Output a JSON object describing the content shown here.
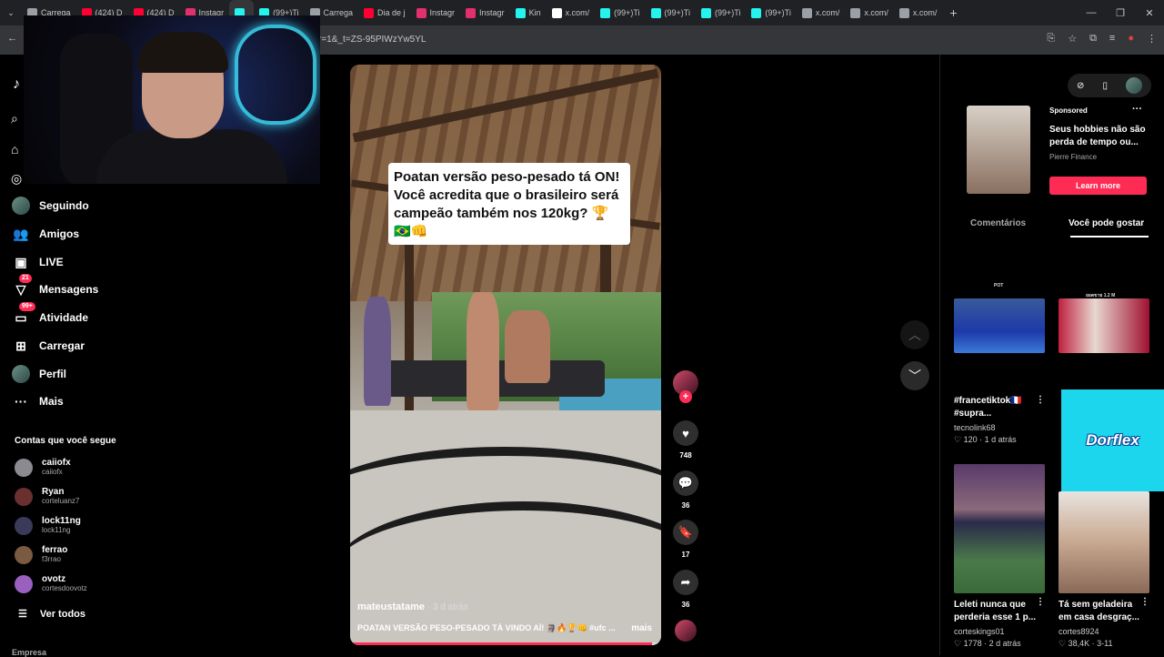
{
  "browser": {
    "tabs": [
      {
        "label": "Carrega",
        "color": "#9aa0a6"
      },
      {
        "label": "(424) D",
        "color": "#ff0033"
      },
      {
        "label": "(424) D",
        "color": "#ff0033"
      },
      {
        "label": "Instagr",
        "color": "#e1306c"
      },
      {
        "label": "",
        "color": "#25f4ee"
      },
      {
        "label": "(99+)Ti",
        "color": "#25f4ee"
      },
      {
        "label": "Carrega",
        "color": "#9aa0a6"
      },
      {
        "label": "Dia de j",
        "color": "#ff0033"
      },
      {
        "label": "Instagr",
        "color": "#e1306c"
      },
      {
        "label": "Instagr",
        "color": "#e1306c"
      },
      {
        "label": "Kin",
        "color": "#25f4ee"
      },
      {
        "label": "x.com/",
        "color": "#ffffff"
      },
      {
        "label": "(99+)Ti",
        "color": "#25f4ee"
      },
      {
        "label": "(99+)Ti",
        "color": "#25f4ee"
      },
      {
        "label": "(99+)Ti",
        "color": "#25f4ee"
      },
      {
        "label": "(99+)Ti",
        "color": "#25f4ee"
      },
      {
        "label": "x.com/",
        "color": "#9aa0a6"
      },
      {
        "label": "x.com/",
        "color": "#9aa0a6"
      },
      {
        "label": "x.com/",
        "color": "#9aa0a6"
      }
    ],
    "new_tab": "+",
    "url": "r=1&_t=ZS-95PIWzYw5YL"
  },
  "sidebar": {
    "items": [
      {
        "label": "Seguindo",
        "icon": "following-icon"
      },
      {
        "label": "Amigos",
        "icon": "friends-icon"
      },
      {
        "label": "LIVE",
        "icon": "live-icon"
      },
      {
        "label": "Mensagens",
        "icon": "messages-icon",
        "badge": "21"
      },
      {
        "label": "Atividade",
        "icon": "activity-icon",
        "badge": "99+"
      },
      {
        "label": "Carregar",
        "icon": "upload-icon"
      },
      {
        "label": "Perfil",
        "icon": "profile-avatar"
      },
      {
        "label": "Mais",
        "icon": "more-icon"
      }
    ],
    "section_title": "Contas que você segue",
    "accounts": [
      {
        "name": "caiiofx",
        "handle": "caiiofx",
        "color": "#8a8a90"
      },
      {
        "name": "Ryan",
        "handle": "corteluanz7",
        "color": "#6a3030"
      },
      {
        "name": "lock11ng",
        "handle": "lock11ng",
        "color": "#3a3a5a"
      },
      {
        "name": "ferrao",
        "handle": "f3rrao",
        "color": "#7a5a40"
      },
      {
        "name": "ovotz",
        "handle": "cortesdoovotz",
        "color": "#9a60c0"
      }
    ],
    "see_all": "Ver todos",
    "footer": "Empresa"
  },
  "video": {
    "caption": "Poatan versão peso-pesado tá ON! Você acredita que o brasileiro será campeão também nos 120kg? 🏆🇧🇷👊",
    "author": "mateustatame",
    "age": " · 3 d atrás",
    "description": "POATAN VERSÃO PESO-PESADO TÁ VINDO AÍ! 🗿🔥🏆👊 #ufc ...",
    "more": "mais",
    "progress": 0.97
  },
  "actions": {
    "likes": "748",
    "comments": "36",
    "saves": "17",
    "shares": "36"
  },
  "right": {
    "ad": {
      "sponsored": "Sponsored",
      "title": "Seus hobbies não são perda de tempo ou...",
      "brand": "Pierre Finance",
      "button": "Learn more"
    },
    "tabs": {
      "comments": "Comentários",
      "you_may_like": "Você pode gostar"
    },
    "cards": [
      {
        "title": "#francetiktok🇫🇷 #supra...",
        "author": "tecnolink68",
        "likes": "120",
        "age": "1 d atrás",
        "top_label": "POT"
      },
      {
        "title": "",
        "author": "",
        "likes": "",
        "age": "",
        "top_label": "ยอดขาย 1.2 M"
      },
      {
        "title": "Leleti nunca que perderia esse 1 p...",
        "author": "corteskings01",
        "likes": "1778",
        "age": "2 d atrás"
      },
      {
        "title": "Tá sem geladeira em casa desgraç...",
        "author": "cortes8924",
        "likes": "38,4K",
        "age": "3-11"
      }
    ],
    "dorflex": "Dorflex"
  }
}
